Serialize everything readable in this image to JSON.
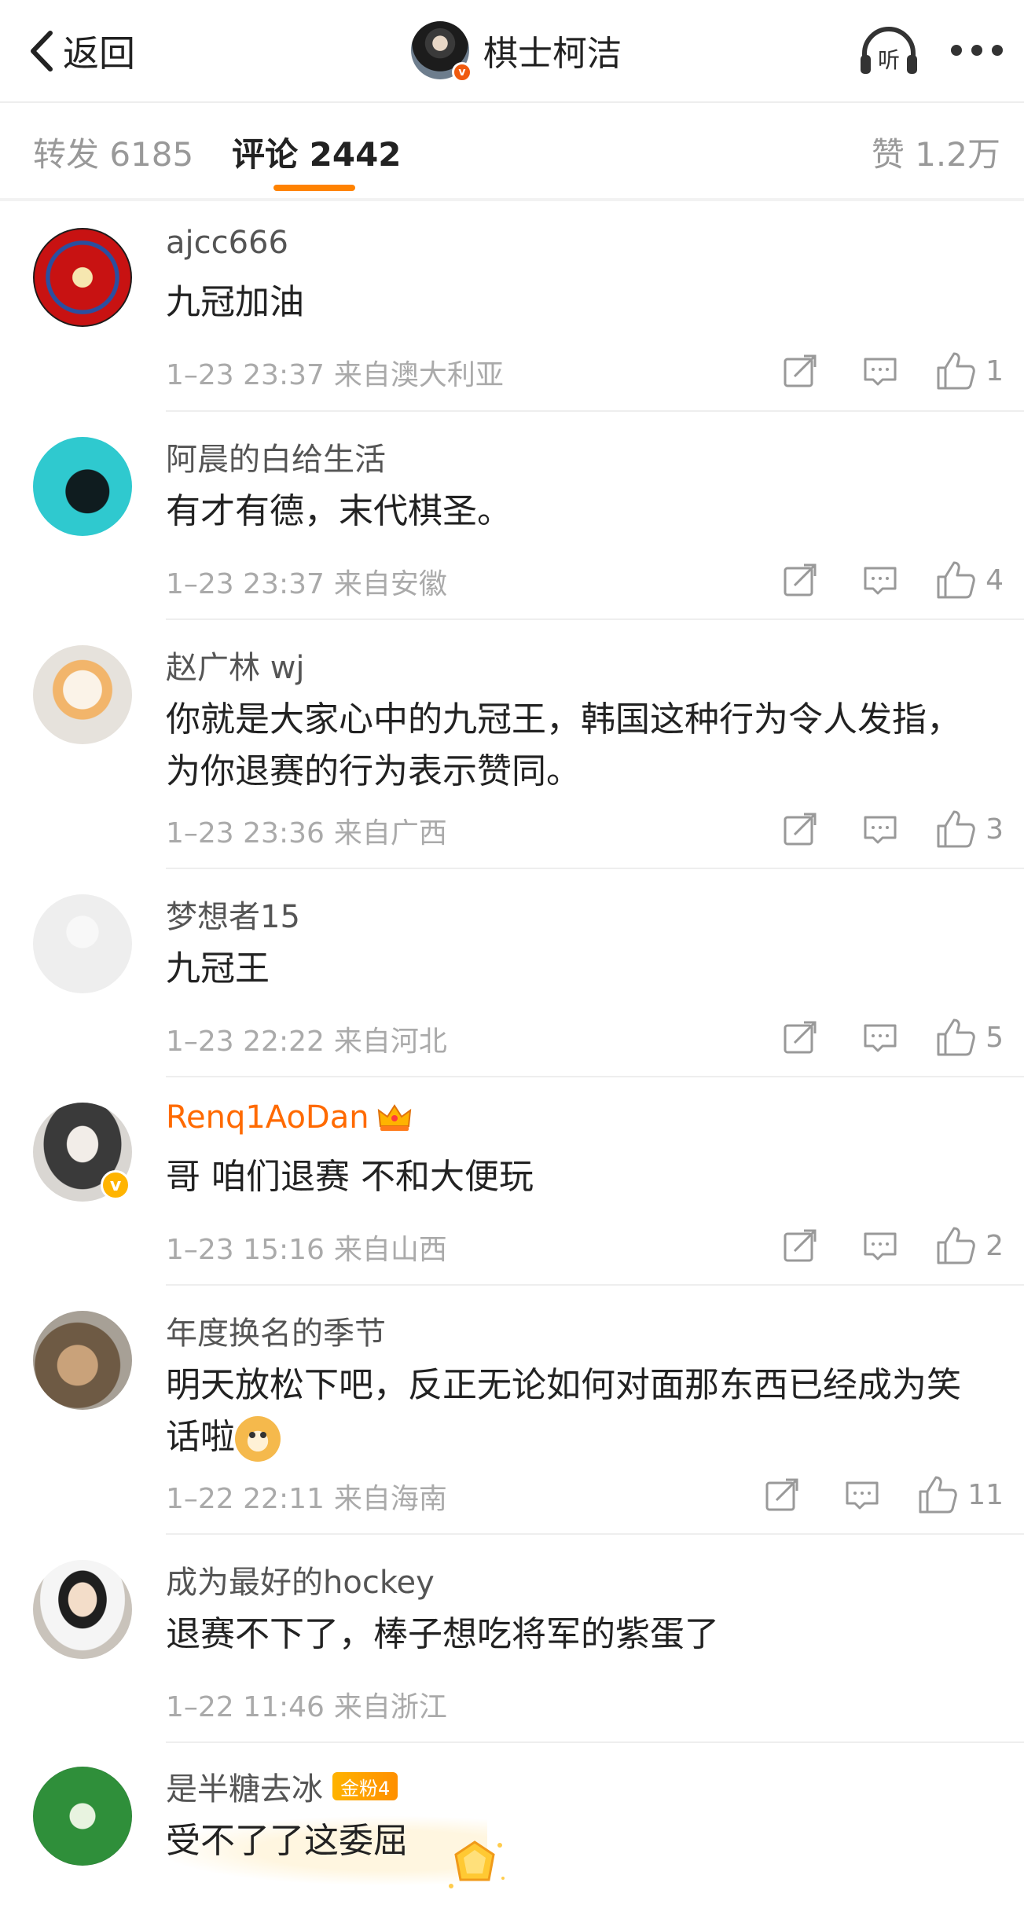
{
  "nav": {
    "back_label": "返回",
    "title": "棋士柯洁",
    "listen_icon_text": "听"
  },
  "tabs": {
    "repost": "转发 6185",
    "comment": "评论 2442",
    "like": "赞 1.2万"
  },
  "colors": {
    "accent": "#ff8200",
    "verified_badge": "#f05a0e",
    "vip_name": "#ff6a00",
    "meta_text": "#aaaaaa"
  },
  "comments": [
    {
      "user": "ajcc666",
      "text": "九冠加油",
      "time": "1–23 23:37",
      "region": "来自澳大利亚",
      "likes": "1"
    },
    {
      "user": "阿晨的白给生活",
      "text": "有才有德，末代棋圣。",
      "time": "1–23 23:37",
      "region": "来自安徽",
      "likes": "4"
    },
    {
      "user": "赵广林 wj",
      "text": "你就是大家心中的九冠王，韩国这种行为令人发指，为你退赛的行为表示赞同。",
      "time": "1–23 23:36",
      "region": "来自广西",
      "likes": "3"
    },
    {
      "user": "梦想者15",
      "text": "九冠王",
      "time": "1–23 22:22",
      "region": "来自河北",
      "likes": "5"
    },
    {
      "user": "Renq1AoDan",
      "text": "哥 咱们退赛 不和大便玩",
      "time": "1–23 15:16",
      "region": "来自山西",
      "likes": "2"
    },
    {
      "user": "年度换名的季节",
      "text": "明天放松下吧，反正无论如何对面那东西已经成为笑话啦",
      "time": "1–22 22:11",
      "region": "来自海南",
      "likes": "11"
    },
    {
      "user": "成为最好的hockey",
      "text": "退赛不下了，棒子想吃将军的紫蛋了",
      "time": "1–22 11:46",
      "region": "来自浙江",
      "likes": ""
    },
    {
      "user": "是半糖去冰",
      "badge": "金粉4",
      "text": "受不了了这委屈",
      "time": "",
      "region": "",
      "likes": ""
    }
  ]
}
